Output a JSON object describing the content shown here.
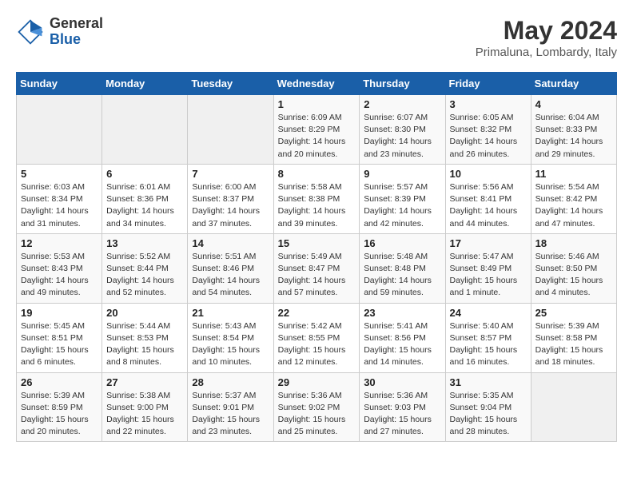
{
  "header": {
    "logo_general": "General",
    "logo_blue": "Blue",
    "title": "May 2024",
    "subtitle": "Primaluna, Lombardy, Italy"
  },
  "days_of_week": [
    "Sunday",
    "Monday",
    "Tuesday",
    "Wednesday",
    "Thursday",
    "Friday",
    "Saturday"
  ],
  "weeks": [
    [
      {
        "num": "",
        "detail": ""
      },
      {
        "num": "",
        "detail": ""
      },
      {
        "num": "",
        "detail": ""
      },
      {
        "num": "1",
        "detail": "Sunrise: 6:09 AM\nSunset: 8:29 PM\nDaylight: 14 hours\nand 20 minutes."
      },
      {
        "num": "2",
        "detail": "Sunrise: 6:07 AM\nSunset: 8:30 PM\nDaylight: 14 hours\nand 23 minutes."
      },
      {
        "num": "3",
        "detail": "Sunrise: 6:05 AM\nSunset: 8:32 PM\nDaylight: 14 hours\nand 26 minutes."
      },
      {
        "num": "4",
        "detail": "Sunrise: 6:04 AM\nSunset: 8:33 PM\nDaylight: 14 hours\nand 29 minutes."
      }
    ],
    [
      {
        "num": "5",
        "detail": "Sunrise: 6:03 AM\nSunset: 8:34 PM\nDaylight: 14 hours\nand 31 minutes."
      },
      {
        "num": "6",
        "detail": "Sunrise: 6:01 AM\nSunset: 8:36 PM\nDaylight: 14 hours\nand 34 minutes."
      },
      {
        "num": "7",
        "detail": "Sunrise: 6:00 AM\nSunset: 8:37 PM\nDaylight: 14 hours\nand 37 minutes."
      },
      {
        "num": "8",
        "detail": "Sunrise: 5:58 AM\nSunset: 8:38 PM\nDaylight: 14 hours\nand 39 minutes."
      },
      {
        "num": "9",
        "detail": "Sunrise: 5:57 AM\nSunset: 8:39 PM\nDaylight: 14 hours\nand 42 minutes."
      },
      {
        "num": "10",
        "detail": "Sunrise: 5:56 AM\nSunset: 8:41 PM\nDaylight: 14 hours\nand 44 minutes."
      },
      {
        "num": "11",
        "detail": "Sunrise: 5:54 AM\nSunset: 8:42 PM\nDaylight: 14 hours\nand 47 minutes."
      }
    ],
    [
      {
        "num": "12",
        "detail": "Sunrise: 5:53 AM\nSunset: 8:43 PM\nDaylight: 14 hours\nand 49 minutes."
      },
      {
        "num": "13",
        "detail": "Sunrise: 5:52 AM\nSunset: 8:44 PM\nDaylight: 14 hours\nand 52 minutes."
      },
      {
        "num": "14",
        "detail": "Sunrise: 5:51 AM\nSunset: 8:46 PM\nDaylight: 14 hours\nand 54 minutes."
      },
      {
        "num": "15",
        "detail": "Sunrise: 5:49 AM\nSunset: 8:47 PM\nDaylight: 14 hours\nand 57 minutes."
      },
      {
        "num": "16",
        "detail": "Sunrise: 5:48 AM\nSunset: 8:48 PM\nDaylight: 14 hours\nand 59 minutes."
      },
      {
        "num": "17",
        "detail": "Sunrise: 5:47 AM\nSunset: 8:49 PM\nDaylight: 15 hours\nand 1 minute."
      },
      {
        "num": "18",
        "detail": "Sunrise: 5:46 AM\nSunset: 8:50 PM\nDaylight: 15 hours\nand 4 minutes."
      }
    ],
    [
      {
        "num": "19",
        "detail": "Sunrise: 5:45 AM\nSunset: 8:51 PM\nDaylight: 15 hours\nand 6 minutes."
      },
      {
        "num": "20",
        "detail": "Sunrise: 5:44 AM\nSunset: 8:53 PM\nDaylight: 15 hours\nand 8 minutes."
      },
      {
        "num": "21",
        "detail": "Sunrise: 5:43 AM\nSunset: 8:54 PM\nDaylight: 15 hours\nand 10 minutes."
      },
      {
        "num": "22",
        "detail": "Sunrise: 5:42 AM\nSunset: 8:55 PM\nDaylight: 15 hours\nand 12 minutes."
      },
      {
        "num": "23",
        "detail": "Sunrise: 5:41 AM\nSunset: 8:56 PM\nDaylight: 15 hours\nand 14 minutes."
      },
      {
        "num": "24",
        "detail": "Sunrise: 5:40 AM\nSunset: 8:57 PM\nDaylight: 15 hours\nand 16 minutes."
      },
      {
        "num": "25",
        "detail": "Sunrise: 5:39 AM\nSunset: 8:58 PM\nDaylight: 15 hours\nand 18 minutes."
      }
    ],
    [
      {
        "num": "26",
        "detail": "Sunrise: 5:39 AM\nSunset: 8:59 PM\nDaylight: 15 hours\nand 20 minutes."
      },
      {
        "num": "27",
        "detail": "Sunrise: 5:38 AM\nSunset: 9:00 PM\nDaylight: 15 hours\nand 22 minutes."
      },
      {
        "num": "28",
        "detail": "Sunrise: 5:37 AM\nSunset: 9:01 PM\nDaylight: 15 hours\nand 23 minutes."
      },
      {
        "num": "29",
        "detail": "Sunrise: 5:36 AM\nSunset: 9:02 PM\nDaylight: 15 hours\nand 25 minutes."
      },
      {
        "num": "30",
        "detail": "Sunrise: 5:36 AM\nSunset: 9:03 PM\nDaylight: 15 hours\nand 27 minutes."
      },
      {
        "num": "31",
        "detail": "Sunrise: 5:35 AM\nSunset: 9:04 PM\nDaylight: 15 hours\nand 28 minutes."
      },
      {
        "num": "",
        "detail": ""
      }
    ]
  ]
}
